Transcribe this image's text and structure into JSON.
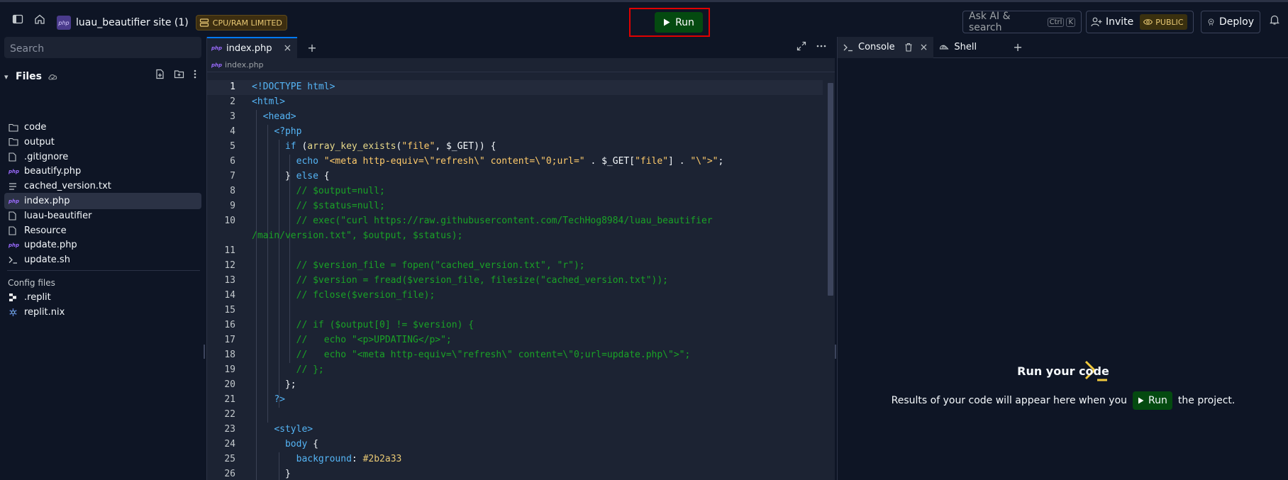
{
  "topbar": {
    "repl_avatar": "php",
    "repl_name": "luau_beautifier site (1)",
    "limited_badge": "CPU/RAM LIMITED",
    "run_label": "Run",
    "ask_ai_placeholder": "Ask AI & search",
    "ask_ai_kbd1": "Ctrl",
    "ask_ai_kbd2": "K",
    "invite_label": "Invite",
    "public_badge": "PUBLIC",
    "deploy_label": "Deploy"
  },
  "sidebar": {
    "search_placeholder": "Search",
    "files_title": "Files",
    "files": [
      {
        "name": "code",
        "icon": "folder-icon"
      },
      {
        "name": "output",
        "icon": "folder-icon"
      },
      {
        "name": ".gitignore",
        "icon": "file-icon"
      },
      {
        "name": "beautify.php",
        "icon": "php-icon"
      },
      {
        "name": "cached_version.txt",
        "icon": "text-file-icon"
      },
      {
        "name": "index.php",
        "icon": "php-icon",
        "active": true
      },
      {
        "name": "luau-beautifier",
        "icon": "file-icon"
      },
      {
        "name": "Resource",
        "icon": "file-icon"
      },
      {
        "name": "update.php",
        "icon": "php-icon"
      },
      {
        "name": "update.sh",
        "icon": "terminal-icon"
      }
    ],
    "config_title": "Config files",
    "config_files": [
      {
        "name": ".replit",
        "icon": "replit-icon"
      },
      {
        "name": "replit.nix",
        "icon": "nix-icon"
      }
    ]
  },
  "editor": {
    "tab_label": "index.php",
    "tab_icon": "php",
    "breadcrumb": "index.php",
    "line_numbers": [
      "1",
      "2",
      "3",
      "4",
      "5",
      "6",
      "7",
      "8",
      "9",
      "10",
      "",
      "11",
      "12",
      "13",
      "14",
      "15",
      "16",
      "17",
      "18",
      "19",
      "20",
      "21",
      "22",
      "23",
      "24",
      "25",
      "26"
    ]
  },
  "console": {
    "console_tab": "Console",
    "shell_tab": "Shell",
    "empty_title": "Run your code",
    "empty_text_before": "Results of your code will appear here when you",
    "empty_run_label": "Run",
    "empty_text_after": "the project."
  },
  "colors": {
    "accent": "#0079f2",
    "run_green": "#044a10",
    "highlight_red": "#e00000",
    "badge_yellow": "#e8c873"
  }
}
